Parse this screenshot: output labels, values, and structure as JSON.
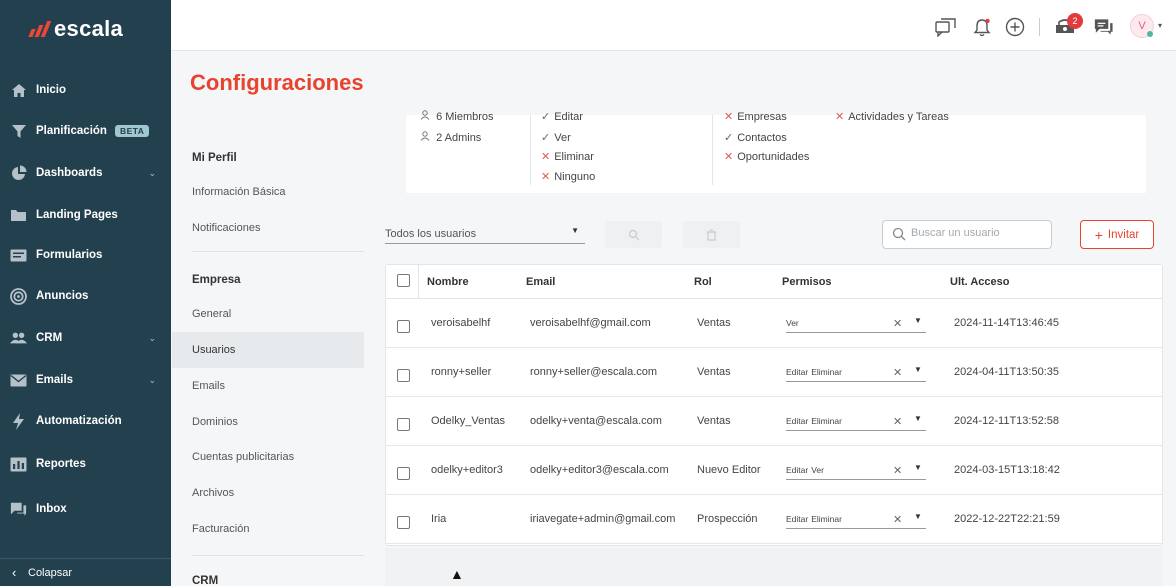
{
  "app": {
    "logo_text": "escala",
    "page_title": "Configuraciones"
  },
  "sidebar": {
    "items": [
      {
        "label": "Inicio",
        "icon": "home-icon"
      },
      {
        "label": "Planificación",
        "icon": "filter-icon",
        "badge": "BETA"
      },
      {
        "label": "Dashboards",
        "icon": "pie-chart-icon"
      },
      {
        "label": "Landing Pages",
        "icon": "folder-icon"
      },
      {
        "label": "Formularios",
        "icon": "form-icon"
      },
      {
        "label": "Anuncios",
        "icon": "target-icon"
      },
      {
        "label": "CRM",
        "icon": "users-icon"
      },
      {
        "label": "Emails",
        "icon": "mail-icon"
      },
      {
        "label": "Automatización",
        "icon": "bolt-icon"
      },
      {
        "label": "Reportes",
        "icon": "bar-chart-icon"
      },
      {
        "label": "Inbox",
        "icon": "chat-icon"
      }
    ],
    "collapse_label": "Colapsar"
  },
  "topbar": {
    "notification_count": "2",
    "avatar_initial": "V"
  },
  "settings_menu": {
    "mi_perfil": "Mi Perfil",
    "informacion_basica": "Información Básica",
    "notificaciones": "Notificaciones",
    "empresa": "Empresa",
    "general": "General",
    "usuarios": "Usuarios",
    "emails": "Emails",
    "dominios": "Dominios",
    "cuentas_publicitarias": "Cuentas publicitarias",
    "archivos": "Archivos",
    "facturacion": "Facturación",
    "crm": "CRM"
  },
  "permissions_card": {
    "members": "6 Miembros",
    "admins": "2 Admins",
    "editar": "Editar",
    "ver": "Ver",
    "eliminar": "Eliminar",
    "ninguno": "Ninguno",
    "empresas": "Empresas",
    "contactos": "Contactos",
    "oportunidades": "Oportunidades",
    "actividades": "Actividades y Tareas"
  },
  "filters": {
    "user_filter_value": "Todos los usuarios",
    "search_placeholder": "Buscar un usuario",
    "invite_label": "Invitar"
  },
  "table": {
    "headers": {
      "name": "Nombre",
      "email": "Email",
      "role": "Rol",
      "permissions": "Permisos",
      "last_access": "Ult. Acceso"
    },
    "rows": [
      {
        "name": "veroisabelhf",
        "email": "veroisabelhf@gmail.com",
        "role": "Ventas",
        "perm1": "Ver",
        "perm2": "",
        "last_access": "2024-11-14T13:46:45"
      },
      {
        "name": "ronny+seller",
        "email": "ronny+seller@escala.com",
        "role": "Ventas",
        "perm1": "Editar",
        "perm2": "Eliminar",
        "last_access": "2024-04-11T13:50:35"
      },
      {
        "name": "Odelky_Ventas",
        "email": "odelky+venta@escala.com",
        "role": "Ventas",
        "perm1": "Editar",
        "perm2": "Eliminar",
        "last_access": "2024-12-11T13:52:58"
      },
      {
        "name": "odelky+editor3",
        "email": "odelky+editor3@escala.com",
        "role": "Nuevo Editor",
        "perm1": "Editar",
        "perm2": "Ver",
        "last_access": "2024-03-15T13:18:42"
      },
      {
        "name": "Iria",
        "email": "iriavegate+admin@gmail.com",
        "role": "Prospección",
        "perm1": "Editar",
        "perm2": "Eliminar",
        "last_access": "2022-12-22T22:21:59"
      }
    ]
  },
  "colors": {
    "sidebar_bg": "#23404e",
    "accent": "#e8432f",
    "beta_badge": "#9fc7cf"
  }
}
